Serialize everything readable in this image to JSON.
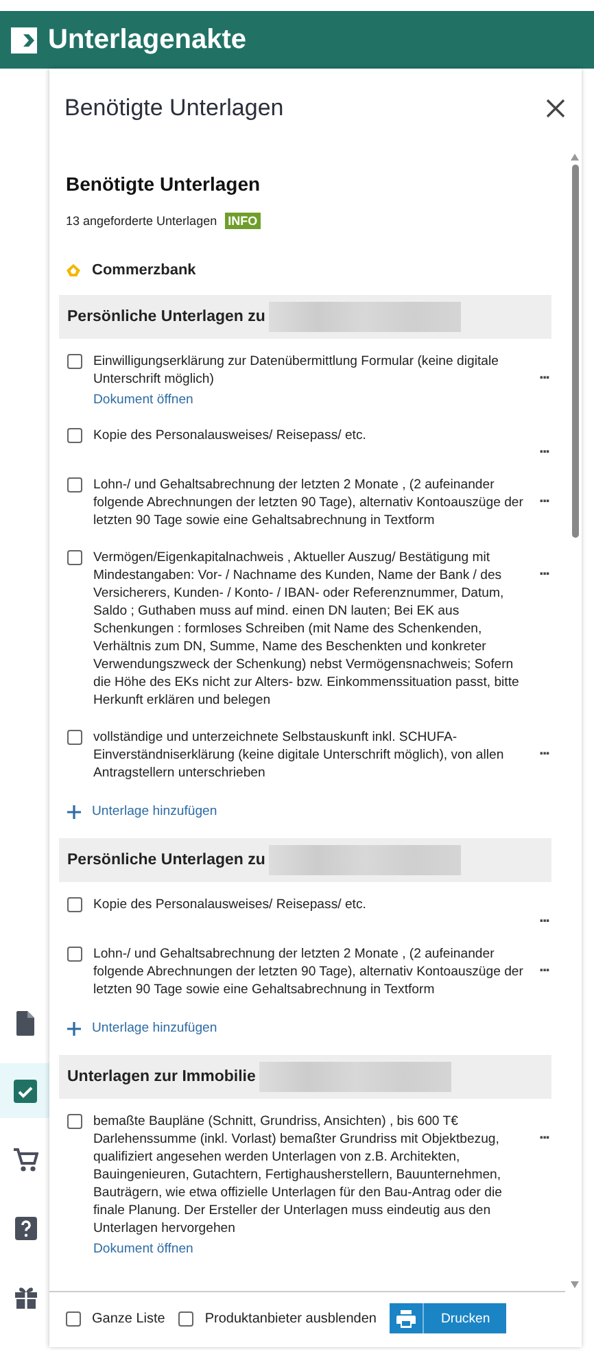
{
  "app_bar": {
    "title": "Unterlagenakte"
  },
  "sidebar": {
    "items": [
      {
        "kind": "document",
        "selected": false
      },
      {
        "kind": "checklist",
        "selected": true
      },
      {
        "kind": "cart",
        "selected": false
      },
      {
        "kind": "help",
        "selected": false
      },
      {
        "kind": "gift",
        "selected": false
      }
    ]
  },
  "panel": {
    "title": "Benötigte Unterlagen",
    "heading": "Benötigte Unterlagen",
    "count": "13 angeforderte Unterlagen",
    "badge": "INFO",
    "provider": "Commerzbank",
    "sections": [
      {
        "title": "Persönliche Unterlagen zu",
        "redacted": true,
        "add_label": "Unterlage hinzufügen",
        "items": [
          {
            "text": "Einwilligungserklärung zur Datenübermittlung Formular (keine digitale Unterschrift möglich)",
            "checked": false,
            "link": "Dokument öffnen",
            "more": "..."
          },
          {
            "text": "Kopie des Personalausweises/ Reisepass/ etc.",
            "checked": false,
            "more": "..."
          },
          {
            "text": "Lohn-/ und Gehaltsabrechnung der letzten 2 Monate , (2 aufeinander folgende Abrechnungen der letzten 90 Tage), alternativ Kontoauszüge der letzten 90 Tage sowie eine Gehaltsabrechnung in Textform",
            "checked": false,
            "more": "..."
          },
          {
            "text": "Vermögen/Eigenkapitalnachweis , Aktueller Auszug/ Bestätigung mit Mindestangaben: Vor- / Nachname des Kunden, Name der Bank / des Versicherers, Kunden- / Konto- / IBAN- oder Referenznummer, Datum, Saldo ; Guthaben muss auf mind. einen DN lauten; Bei EK aus Schenkungen : formloses Schreiben (mit Name des Schenkenden, Verhältnis zum DN, Summe, Name des Beschenkten und konkreter Verwendungszweck der Schenkung) nebst Vermögensnachweis; Sofern die Höhe des EKs nicht zur Alters- bzw. Einkommenssituation passt, bitte Herkunft erklären und belegen",
            "checked": false,
            "more": "..."
          },
          {
            "text": "vollständige und unterzeichnete Selbstauskunft inkl. SCHUFA-Einverständniserklärung (keine digitale Unterschrift möglich), von allen Antragstellern unterschrieben",
            "checked": false,
            "more": "..."
          }
        ]
      },
      {
        "title": "Persönliche Unterlagen zu",
        "redacted": true,
        "add_label": "Unterlage hinzufügen",
        "items": [
          {
            "text": "Kopie des Personalausweises/ Reisepass/ etc.",
            "checked": false,
            "more": "..."
          },
          {
            "text": "Lohn-/ und Gehaltsabrechnung der letzten 2 Monate , (2 aufeinander folgende Abrechnungen der letzten 90 Tage), alternativ Kontoauszüge der letzten 90 Tage sowie eine Gehaltsabrechnung in Textform",
            "checked": false,
            "more": "..."
          }
        ]
      },
      {
        "title": "Unterlagen zur Immobilie",
        "redacted": true,
        "items": [
          {
            "text": "bemaßte Baupläne (Schnitt, Grundriss, Ansichten) , bis 600 T€ Darlehenssumme (inkl. Vorlast) bemaßter Grundriss mit Objektbezug, qualifiziert angesehen werden Unterlagen von z.B. Architekten, Bauingenieuren, Gutachtern, Fertighausherstellern, Bauunternehmen, Bauträgern, wie etwa offizielle Unterlagen für den Bau-Antrag oder die finale Planung. Der Ersteller der Unterlagen muss eindeutig aus den Unterlagen hervorgehen",
            "checked": false,
            "link": "Dokument öffnen",
            "more": "..."
          }
        ]
      }
    ],
    "footer": {
      "options": [
        {
          "label": "Ganze Liste",
          "checked": false
        },
        {
          "label": "Produktanbieter ausblenden",
          "checked": false
        }
      ],
      "print_label": "Drucken"
    }
  }
}
